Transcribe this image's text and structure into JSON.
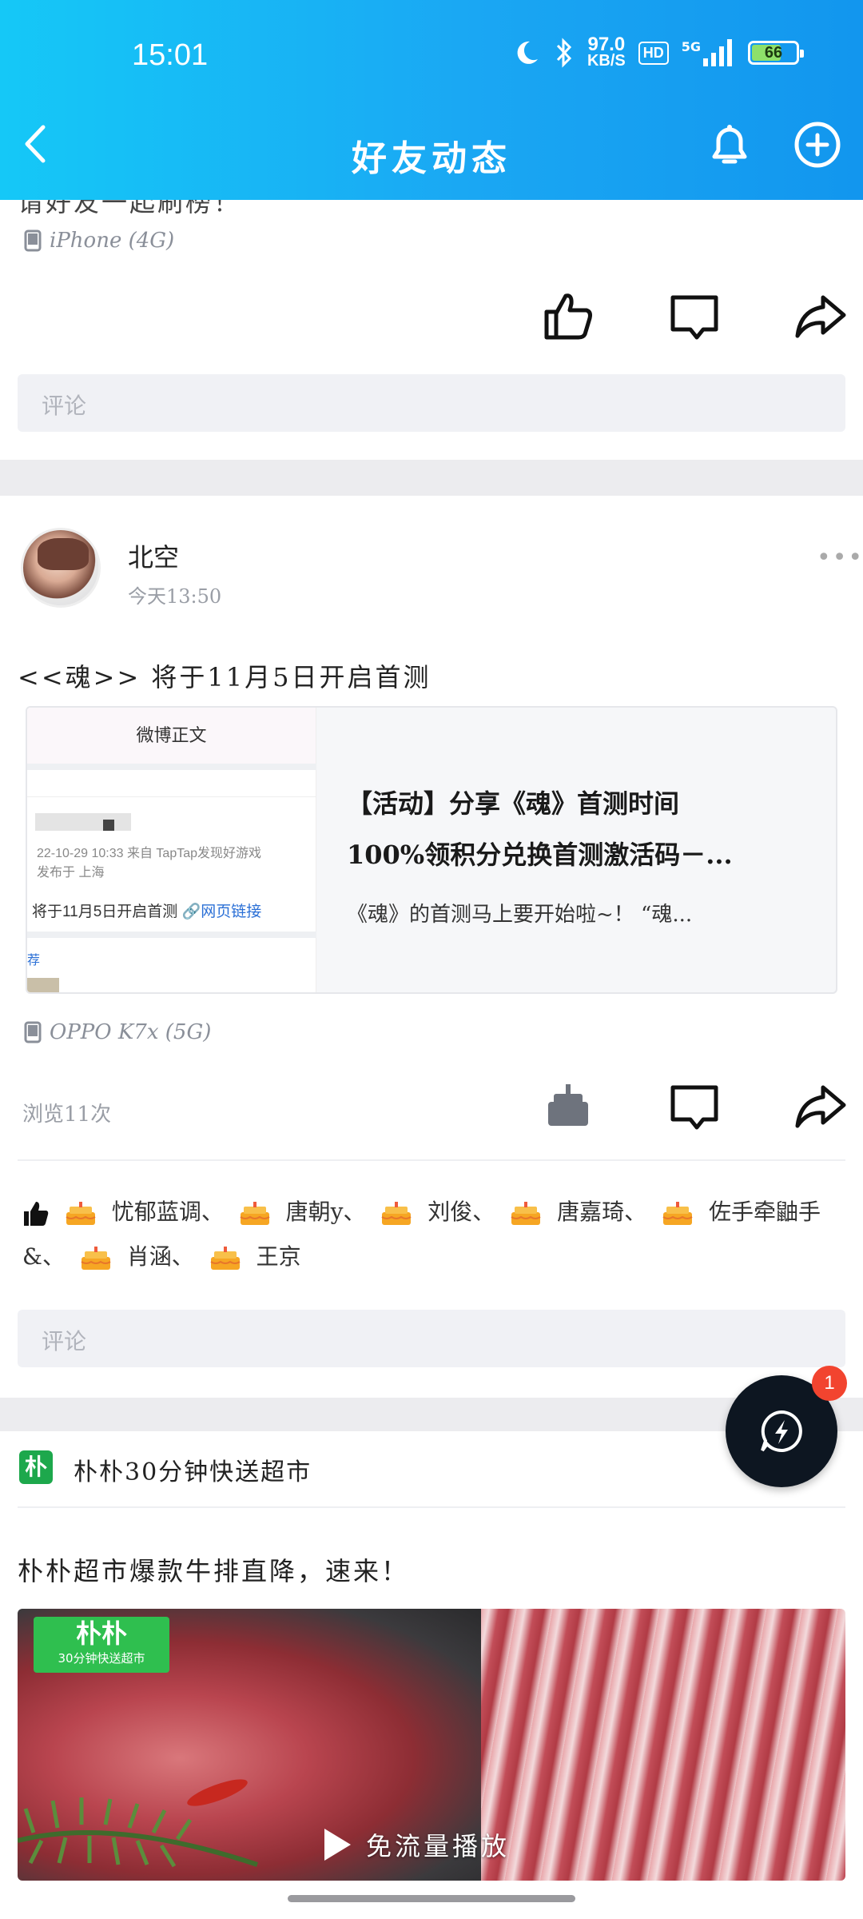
{
  "status_bar": {
    "time": "15:01",
    "net_speed_value": "97.0",
    "net_speed_unit": "KB/S",
    "hd": "HD",
    "signal": "5G",
    "battery": "66"
  },
  "header": {
    "title": "好友动态"
  },
  "post_prev": {
    "text_fragment": "请好友一起刷榜！",
    "device": "iPhone (4G)",
    "comment_placeholder": "评论"
  },
  "post_main": {
    "author": "北空",
    "time": "今天13:50",
    "text": "<<魂>> 将于11月5日开启首测",
    "link": {
      "thumb_header": "微博正文",
      "thumb_meta_time": "22-10-29 10:33  来自 TapTap发现好游戏",
      "thumb_meta_loc": "发布于 上海",
      "thumb_title": "将于11月5日开启首测",
      "thumb_link": "🔗网页链接",
      "thumb_tag": "荐",
      "title_line1": "【活动】分享《魂》首测时间",
      "title_line2": "100%领积分兑换首测激活码－...",
      "desc": "《魂》的首测马上要开始啦~！ “魂..."
    },
    "device": "OPPO K7x (5G)",
    "views": "浏览11次",
    "likers_text": "忧郁蓝调、  唐朝y、  刘俊、  唐嘉琦、  佐手牵\n鼬手&、  肖涵、  王京",
    "likers": [
      "忧郁蓝调",
      "唐朝y",
      "刘俊",
      "唐嘉琦",
      "佐手牵鼬手&",
      "肖涵",
      "王京"
    ],
    "comment_placeholder": "评论"
  },
  "post_ad": {
    "brand_badge": "朴",
    "brand": "朴朴30分钟快送超市",
    "text": "朴朴超市爆款牛排直降，速来！",
    "video_brand": "朴朴",
    "video_brand_sub": "30分钟快送超市",
    "video_play": "免流量播放"
  },
  "fab": {
    "badge": "1"
  },
  "colors": {
    "header_start": "#15c8f7",
    "header_end": "#1296ee",
    "fab_bg": "#0d1621",
    "badge_red": "#f2442f",
    "brand_green": "#1da84c"
  }
}
